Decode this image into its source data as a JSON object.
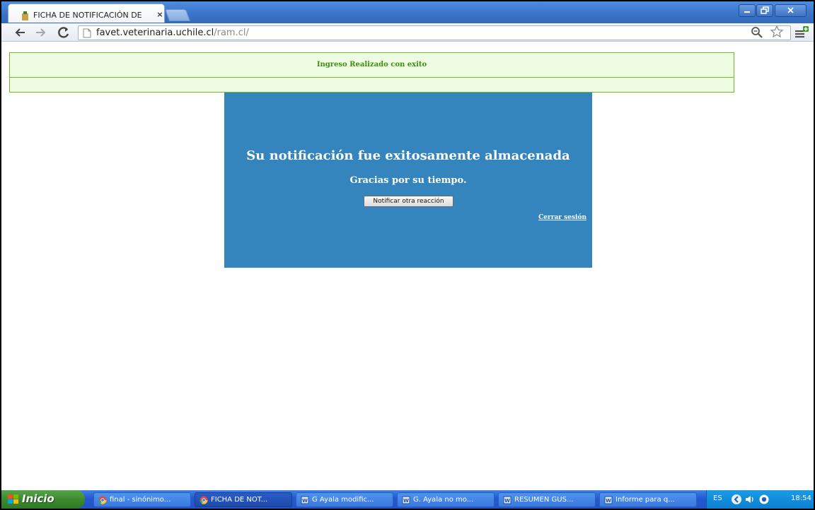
{
  "browser": {
    "tab_title": "FICHA DE NOTIFICACIÓN DE",
    "tab_close": "×",
    "url_host": "favet.veterinaria.uchile.cl",
    "url_path": "/ram.cl/"
  },
  "page": {
    "success_message": "Ingreso Realizado con exito",
    "panel_title": "Su notificación fue exitosamente almacenada",
    "panel_subtitle": "Gracias por su tiempo.",
    "notify_button": "Notificar otra reacción",
    "logout_link": "Cerrar sesión"
  },
  "taskbar": {
    "start_label": "Inicio",
    "tasks": [
      {
        "label": "final - sinónimo...",
        "icon": "chrome-icon",
        "active": false
      },
      {
        "label": "FICHA DE NOT...",
        "icon": "chrome-icon",
        "active": true
      },
      {
        "label": "G Ayala modific...",
        "icon": "word-icon",
        "active": false
      },
      {
        "label": "G. Ayala no mo...",
        "icon": "word-icon",
        "active": false
      },
      {
        "label": "RESUMEN GUS...",
        "icon": "word-icon",
        "active": false
      },
      {
        "label": "Informe para q...",
        "icon": "word-icon",
        "active": false
      }
    ],
    "language": "ES",
    "clock": "18:54"
  },
  "colors": {
    "panel_bg": "#3485bd",
    "success_bg": "#eefde2",
    "success_border": "#6fbb2c",
    "success_text": "#3a8f0f"
  }
}
